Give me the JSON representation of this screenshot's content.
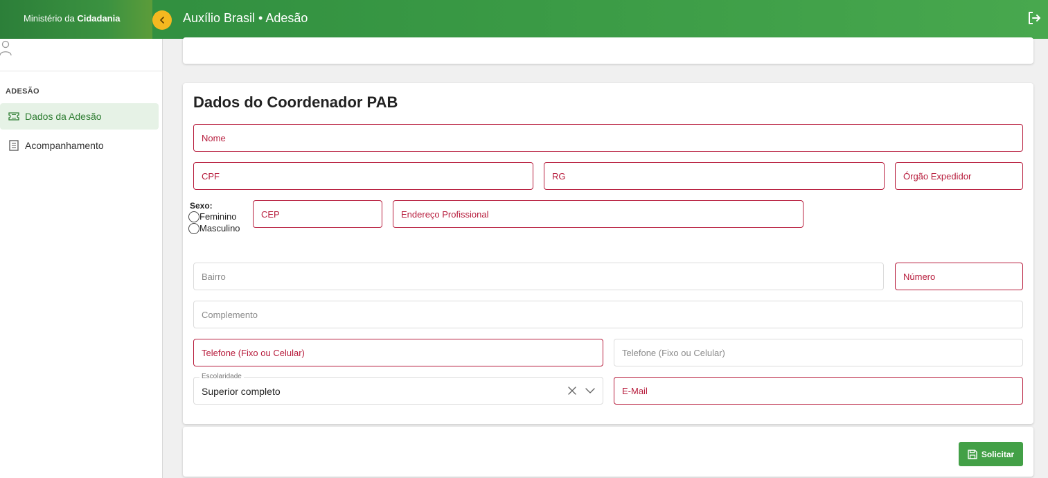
{
  "header": {
    "ministry_prefix": "Ministério da",
    "ministry_name": "Cidadania",
    "app_title": "Auxílio Brasil • Adesão"
  },
  "sidebar": {
    "section_title": "ADESÃO",
    "items": [
      {
        "label": "Dados da Adesão",
        "icon": "ticket-icon",
        "active": true
      },
      {
        "label": "Acompanhamento",
        "icon": "document-icon",
        "active": false
      }
    ]
  },
  "form": {
    "title": "Dados do Coordenador PAB",
    "fields": {
      "nome": "Nome",
      "cpf": "CPF",
      "rg": "RG",
      "orgao_expedidor": "Órgão Expedidor",
      "cep": "CEP",
      "endereco_profissional": "Endereço Profissional",
      "bairro": "Bairro",
      "numero": "Número",
      "complemento": "Complemento",
      "telefone_1": "Telefone (Fixo ou Celular)",
      "telefone_2": "Telefone (Fixo ou Celular)",
      "email": "E-Mail"
    },
    "sexo": {
      "label": "Sexo:",
      "options": [
        "Feminino",
        "Masculino"
      ]
    },
    "escolaridade": {
      "label": "Escolaridade",
      "value": "Superior completo"
    },
    "submit_label": "Solicitar"
  },
  "colors": {
    "header_green": "#3a9a45",
    "accent_yellow": "#f5b820",
    "error_red": "#b71c3c",
    "button_green": "#43a047",
    "active_bg": "#e6f2e6"
  }
}
